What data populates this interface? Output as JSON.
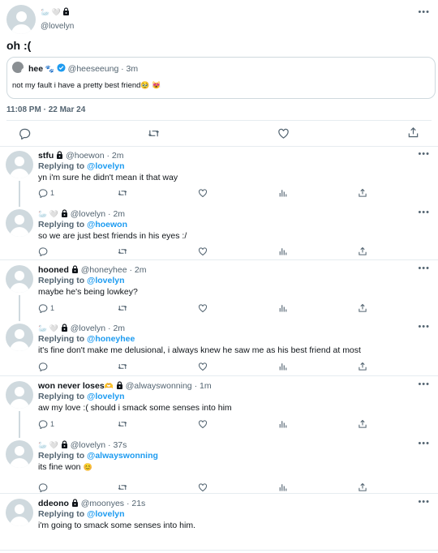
{
  "main_tweet": {
    "emojis": "🦢 🤍",
    "handle": "@lovelyn",
    "text": "oh :(",
    "timestamp": "11:08 PM · 22 Mar 24",
    "quoted": {
      "name": "hee",
      "name_emoji": "🐾",
      "handle": "@heeseeung",
      "time": "· 3m",
      "text": "not my fault i have a pretty best friend",
      "text_emojis": "🥹 😻"
    }
  },
  "replies": [
    {
      "name": "stfu",
      "handle": "@hoewon",
      "time": "· 2m",
      "replying_prefix": "Replying to",
      "replying_to": "@lovelyn",
      "text": "yn i'm sure he didn't mean it that way",
      "reply_count": "1"
    },
    {
      "name": "🦢 🤍",
      "handle": "@lovelyn",
      "time": "· 2m",
      "replying_prefix": "Replying to",
      "replying_to": "@hoewon",
      "text": "so we are just best friends in his eyes :/",
      "reply_count": ""
    },
    {
      "name": "hooned",
      "handle": "@honeyhee",
      "time": "· 2m",
      "replying_prefix": "Replying to",
      "replying_to": "@lovelyn",
      "text": "maybe he's being lowkey?",
      "reply_count": "1"
    },
    {
      "name": "🦢 🤍",
      "handle": "@lovelyn",
      "time": "· 2m",
      "replying_prefix": "Replying to",
      "replying_to": "@honeyhee",
      "text": "it's fine don't make me delusional, i always knew he saw me as his best friend at most",
      "reply_count": ""
    },
    {
      "name": "won never loses",
      "name_emoji": "🫶",
      "handle": "@alwayswonning",
      "time": "· 1m",
      "replying_prefix": "Replying to",
      "replying_to": "@lovelyn",
      "text": "aw my love :( should i smack some senses into him",
      "reply_count": "1"
    },
    {
      "name": "🦢 🤍",
      "handle": "@lovelyn",
      "time": "· 37s",
      "replying_prefix": "Replying to",
      "replying_to": "@alwayswonning",
      "text": "its fine won",
      "text_emoji": "😊",
      "reply_count": ""
    },
    {
      "name": "ddeono",
      "handle": "@moonyes",
      "time": "· 21s",
      "replying_prefix": "Replying to",
      "replying_to": "@lovelyn",
      "text": "i'm going to smack some senses into him.",
      "reply_count": ""
    }
  ],
  "icons": [
    "more-icon",
    "lock-icon",
    "verified-icon",
    "reply-icon",
    "retweet-icon",
    "like-icon",
    "views-icon",
    "share-icon"
  ],
  "colors": {
    "accent": "#1d9bf0",
    "secondary_text": "#536471",
    "divider": "#e6ecf0"
  }
}
